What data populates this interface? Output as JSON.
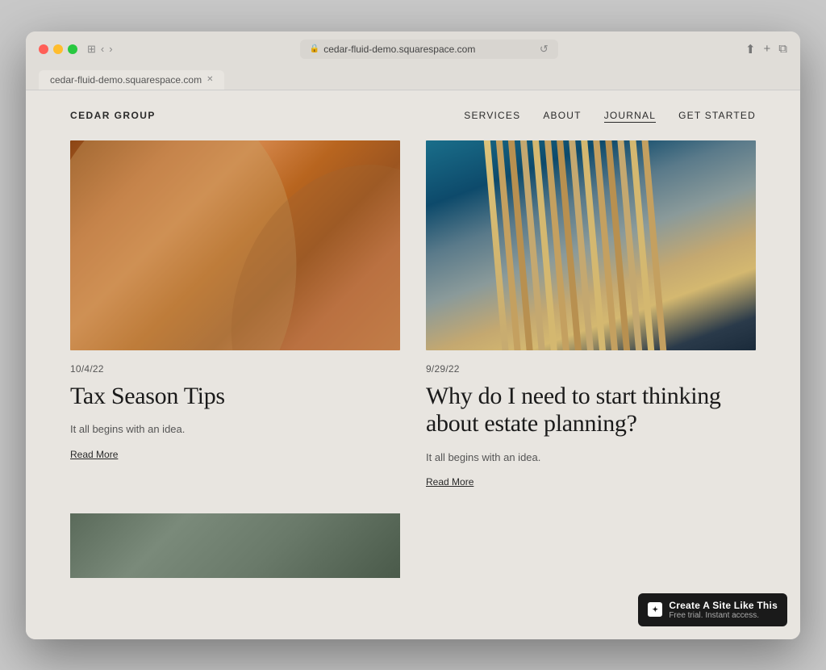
{
  "browser": {
    "url": "cedar-fluid-demo.squarespace.com",
    "tab_label": "cedar-fluid-demo.squarespace.com"
  },
  "site": {
    "logo": "CEDAR GROUP",
    "nav": [
      {
        "id": "services",
        "label": "SERVICES",
        "active": false
      },
      {
        "id": "about",
        "label": "ABOUT",
        "active": false
      },
      {
        "id": "journal",
        "label": "JOURNAL",
        "active": true
      },
      {
        "id": "get-started",
        "label": "GET STARTED",
        "active": false
      }
    ]
  },
  "posts": [
    {
      "id": "post-1",
      "date": "10/4/22",
      "title": "Tax Season Tips",
      "excerpt": "It all begins with an idea.",
      "read_more": "Read More",
      "image_type": "warm"
    },
    {
      "id": "post-2",
      "date": "9/29/22",
      "title": "Why do I need to start thinking about estate planning?",
      "excerpt": "It all begins with an idea.",
      "read_more": "Read More",
      "image_type": "arch"
    }
  ],
  "badge": {
    "main": "Create A Site Like This",
    "sub": "Free trial. Instant access."
  }
}
